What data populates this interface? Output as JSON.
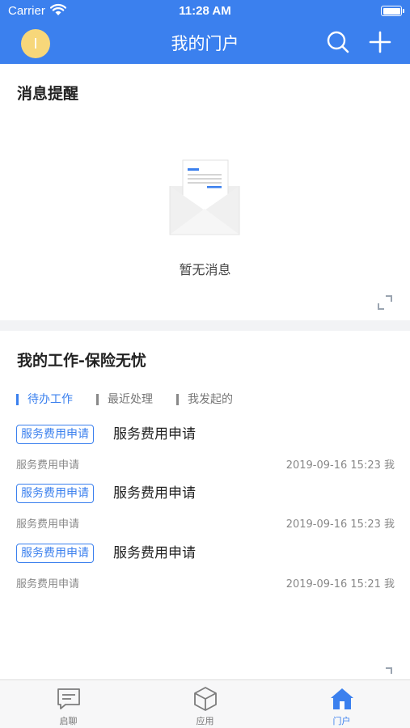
{
  "status_bar": {
    "carrier": "Carrier",
    "time": "11:28 AM"
  },
  "nav": {
    "avatar_initial": "I",
    "title": "我的门户"
  },
  "messages": {
    "title": "消息提醒",
    "empty_text": "暂无消息"
  },
  "work": {
    "title": "我的工作-保险无忧",
    "tabs": [
      {
        "label": "待办工作",
        "active": true
      },
      {
        "label": "最近处理",
        "active": false
      },
      {
        "label": "我发起的",
        "active": false
      }
    ],
    "items": [
      {
        "tag": "服务费用申请",
        "title": "服务费用申请",
        "subtitle": "服务费用申请",
        "meta": "2019-09-16 15:23 我"
      },
      {
        "tag": "服务费用申请",
        "title": "服务费用申请",
        "subtitle": "服务费用申请",
        "meta": "2019-09-16 15:23 我"
      },
      {
        "tag": "服务费用申请",
        "title": "服务费用申请",
        "subtitle": "服务费用申请",
        "meta": "2019-09-16 15:21 我"
      }
    ]
  },
  "tabbar": {
    "items": [
      {
        "label": "启聊",
        "icon": "chat-icon",
        "active": false
      },
      {
        "label": "应用",
        "icon": "cube-icon",
        "active": false
      },
      {
        "label": "门户",
        "icon": "home-icon",
        "active": true
      }
    ]
  },
  "colors": {
    "brand": "#3b80ee",
    "avatar": "#f7d77a",
    "background": "#f2f3f5"
  }
}
